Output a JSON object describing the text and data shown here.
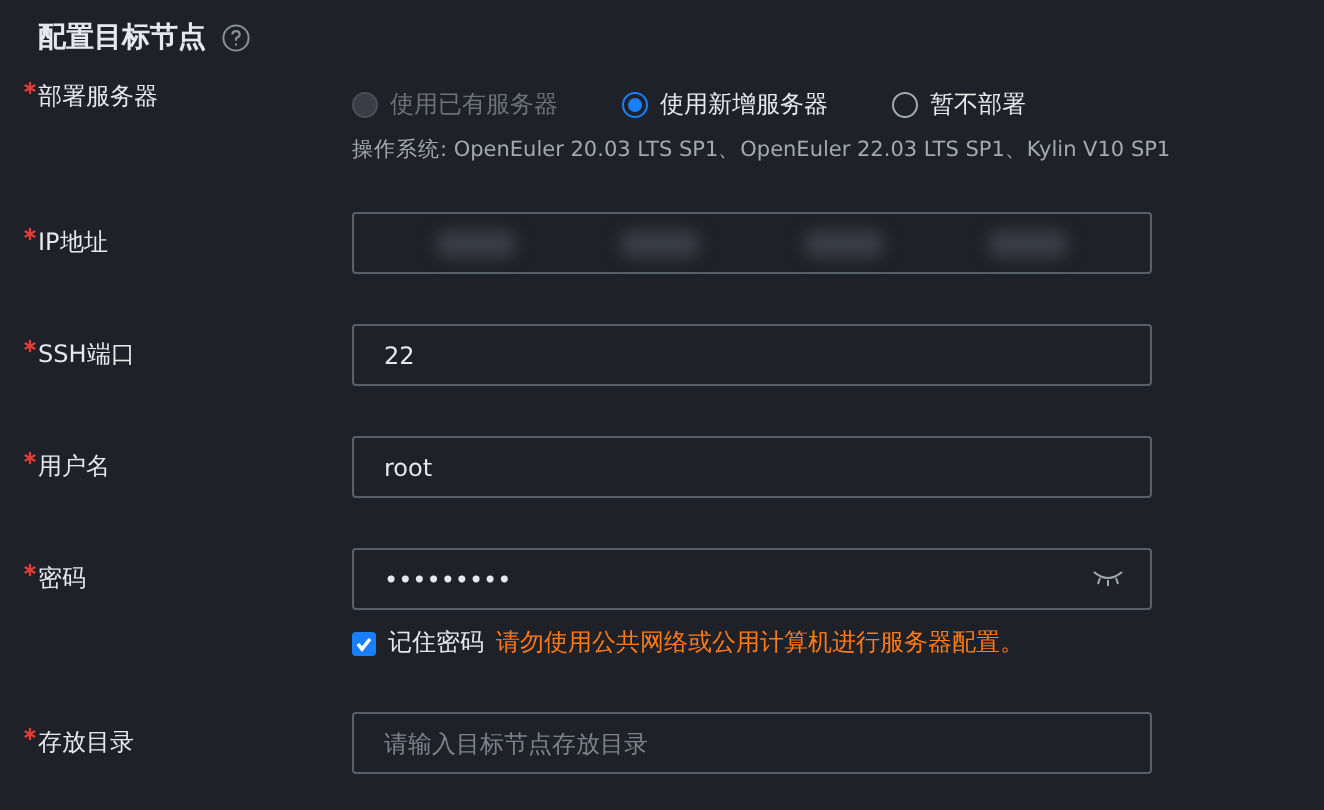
{
  "section": {
    "title": "配置目标节点"
  },
  "fields": [
    {
      "kind": "radio",
      "label": "部署服务器",
      "required": true,
      "options": [
        {
          "label": "使用已有服务器",
          "selected": false,
          "disabled": true
        },
        {
          "label": "使用新增服务器",
          "selected": true,
          "disabled": false
        },
        {
          "label": "暂不部署",
          "selected": false,
          "disabled": false
        }
      ],
      "hint": "操作系统: OpenEuler 20.03 LTS SP1、OpenEuler 22.03 LTS SP1、Kylin V10 SP1"
    },
    {
      "kind": "redacted",
      "label": "IP地址",
      "required": true
    },
    {
      "kind": "text",
      "label": "SSH端口",
      "required": true,
      "value": "22"
    },
    {
      "kind": "text",
      "label": "用户名",
      "required": true,
      "value": "root"
    },
    {
      "kind": "password",
      "label": "密码",
      "required": true,
      "value": "•••••••••",
      "remember": {
        "label": "记住密码",
        "checked": true
      },
      "warning": "请勿使用公共网络或公用计算机进行服务器配置。"
    },
    {
      "kind": "text",
      "label": "存放目录",
      "required": true,
      "placeholder": "请输入目标节点存放目录"
    }
  ]
}
